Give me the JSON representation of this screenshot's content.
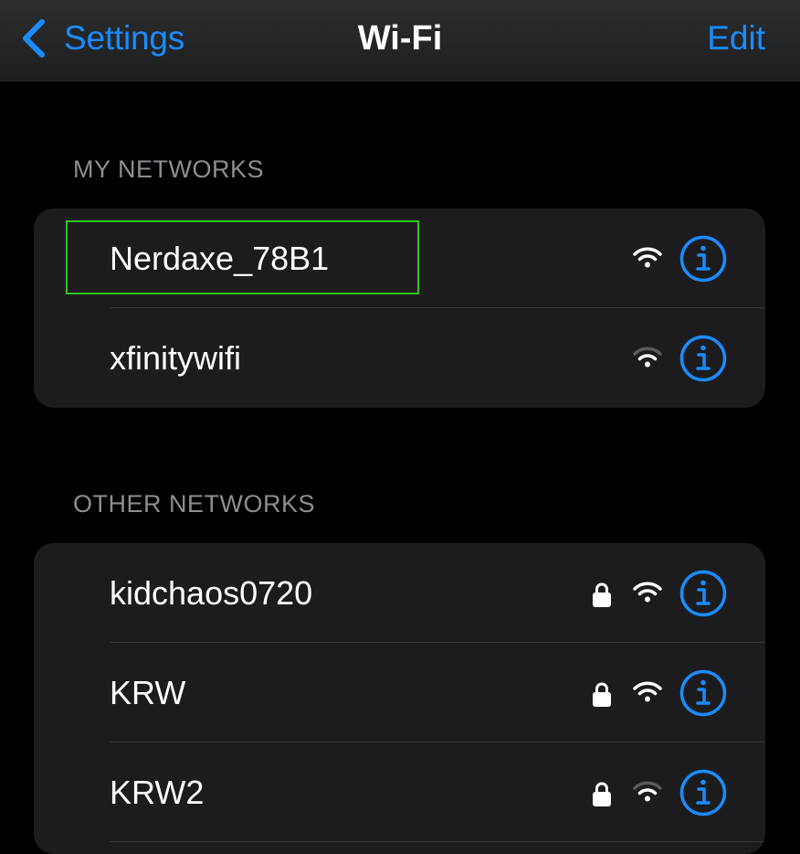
{
  "navbar": {
    "back_label": "Settings",
    "title": "Wi-Fi",
    "edit_label": "Edit"
  },
  "my_networks": {
    "header": "MY NETWORKS",
    "items": [
      {
        "name": "Nerdaxe_78B1",
        "locked": false,
        "signal": "full",
        "highlighted": true
      },
      {
        "name": "xfinitywifi",
        "locked": false,
        "signal": "medium"
      }
    ]
  },
  "other_networks": {
    "header": "OTHER NETWORKS",
    "items": [
      {
        "name": "kidchaos0720",
        "locked": true,
        "signal": "full"
      },
      {
        "name": "KRW",
        "locked": true,
        "signal": "full"
      },
      {
        "name": "KRW2",
        "locked": true,
        "signal": "medium"
      }
    ]
  },
  "colors": {
    "accent": "#1a8cff",
    "background": "#000000",
    "group_background": "#1c1c1e",
    "separator": "#38383a",
    "secondary_text": "#8d8d93",
    "highlight_box": "#2fc41e"
  },
  "icons": {
    "back": "chevron-left-icon",
    "lock": "lock-icon",
    "wifi": "wifi-signal-icon",
    "info": "info-circle-icon"
  }
}
